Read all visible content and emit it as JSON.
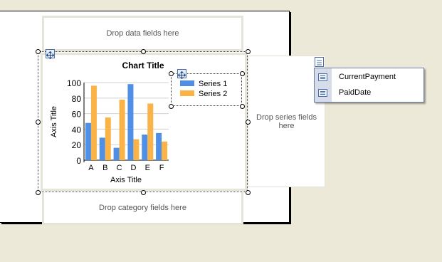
{
  "drop_zones": {
    "data": "Drop data fields here",
    "category": "Drop category fields here",
    "series": "Drop series fields here"
  },
  "fields": [
    "CurrentPayment",
    "PaidDate"
  ],
  "colors": {
    "series1": "#4f8fe6",
    "series2": "#f9b347"
  },
  "chart_data": {
    "type": "bar",
    "title": "Chart Title",
    "xlabel": "Axis Title",
    "ylabel": "Axis Title",
    "categories": [
      "A",
      "B",
      "C",
      "D",
      "E",
      "F"
    ],
    "series": [
      {
        "name": "Series 1",
        "values": [
          48,
          29,
          16,
          98,
          33,
          35
        ]
      },
      {
        "name": "Series 2",
        "values": [
          96,
          55,
          78,
          27,
          73,
          24
        ]
      }
    ],
    "ylim": [
      0,
      100
    ],
    "yticks": [
      0,
      20,
      40,
      60,
      80,
      100
    ],
    "grid": true,
    "legend": "top-right"
  }
}
